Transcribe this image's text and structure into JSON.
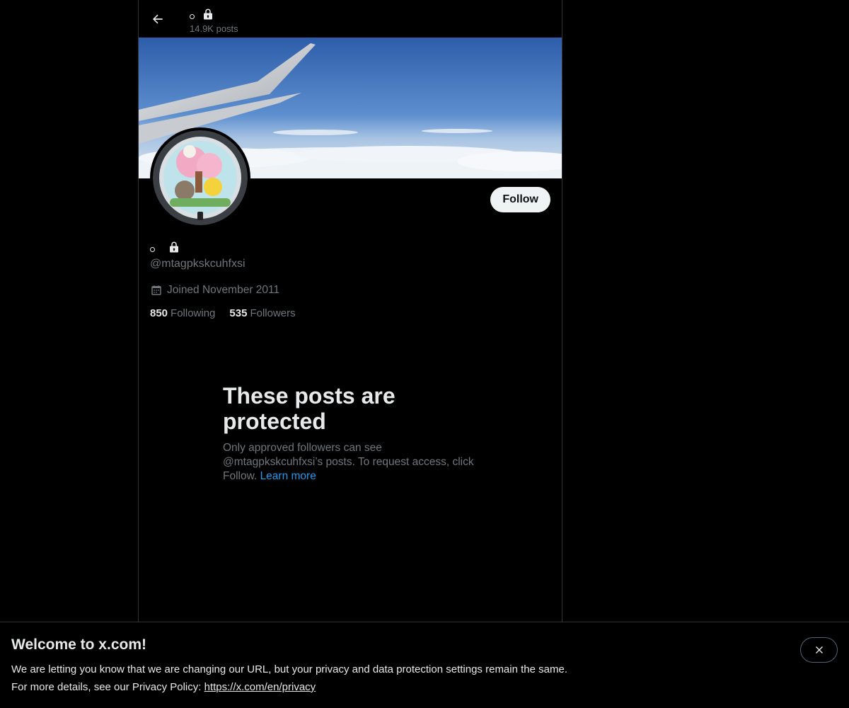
{
  "topbar": {
    "name": "",
    "posts_count": "14.9K posts"
  },
  "profile": {
    "handle": "@mtagpkskcuhfxsi",
    "joined": "Joined November 2011",
    "following_count": "850",
    "following_label": "Following",
    "followers_count": "535",
    "followers_label": "Followers",
    "follow_button": "Follow"
  },
  "protected": {
    "title": "These posts are protected",
    "body": "Only approved followers can see @mtagpkskcuhfxsi’s posts. To request access, click Follow.",
    "learn_more": "Learn more"
  },
  "notice": {
    "title": "Welcome to x.com!",
    "line1": "We are letting you know that we are changing our URL, but your privacy and data protection settings remain the same.",
    "line2_prefix": "For more details, see our Privacy Policy:",
    "privacy_link": "https://x.com/en/privacy"
  },
  "colors": {
    "background": "#000000",
    "text_primary": "#e7e9ea",
    "text_secondary": "#71767b",
    "link": "#1d9bf0",
    "follow_button_bg": "#eff3f4"
  },
  "icons": {
    "back": "arrow-left-icon",
    "lock": "lock-icon",
    "calendar": "calendar-icon",
    "close": "close-icon"
  }
}
